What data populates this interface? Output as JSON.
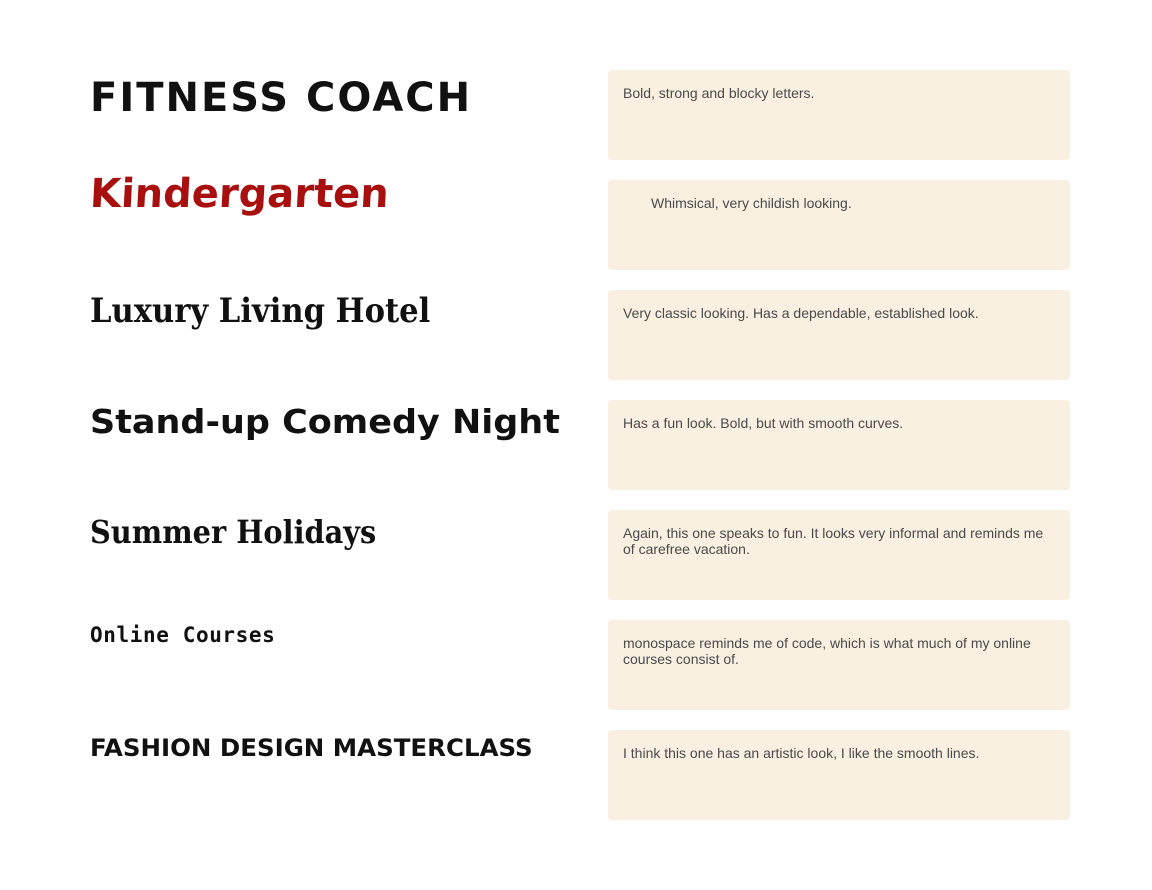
{
  "rows": [
    {
      "sample": "FITNESS COACH",
      "comment": "Bold, strong and blocky letters."
    },
    {
      "sample": "Kindergarten",
      "comment": "Whimsical, very childish looking.",
      "sample_color": "#a80f0f"
    },
    {
      "sample": "Luxury Living Hotel",
      "comment": "Very classic looking. Has a dependable, established look."
    },
    {
      "sample": "Stand-up Comedy Night",
      "comment": "Has a fun look. Bold, but with smooth curves."
    },
    {
      "sample": "Summer Holidays",
      "comment": "Again, this one speaks to fun. It looks very informal and reminds me of carefree vacation."
    },
    {
      "sample": "Online Courses",
      "comment": "monospace reminds me of code, which is what much of my online courses consist of."
    },
    {
      "sample": "FASHION DESIGN MASTERCLASS",
      "comment": "I think this one has an artistic look,  I like the smooth lines."
    }
  ],
  "colors": {
    "note_background": "#f9f0e1",
    "note_text": "#4a4a4a",
    "sample_text": "#111111"
  }
}
